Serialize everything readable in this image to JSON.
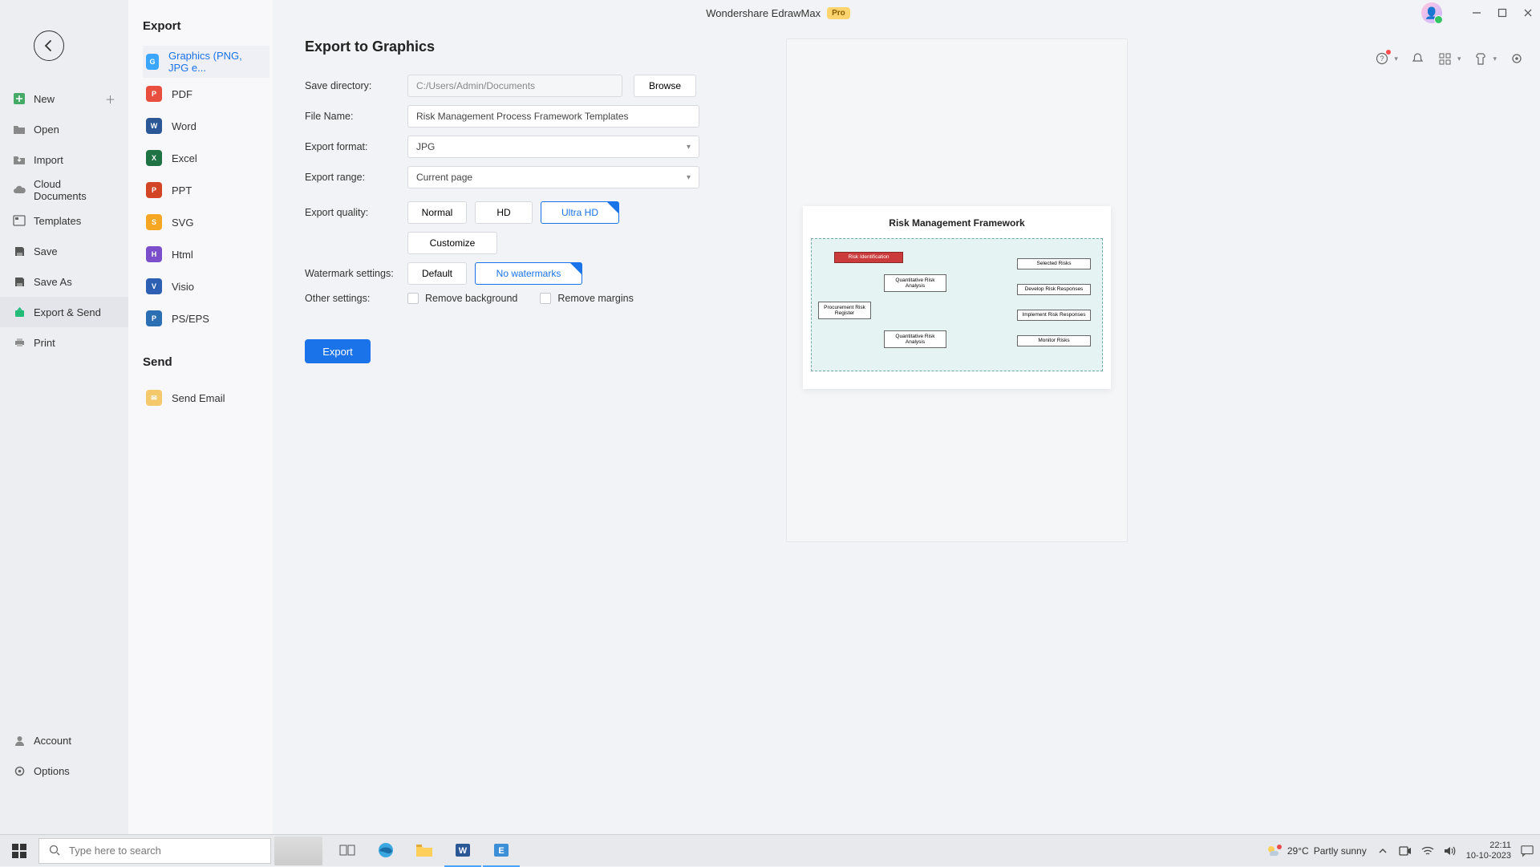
{
  "titlebar": {
    "app_title": "Wondershare EdrawMax",
    "pro_badge": "Pro"
  },
  "leftnav": {
    "items": [
      {
        "label": "New"
      },
      {
        "label": "Open"
      },
      {
        "label": "Import"
      },
      {
        "label": "Cloud Documents"
      },
      {
        "label": "Templates"
      },
      {
        "label": "Save"
      },
      {
        "label": "Save As"
      },
      {
        "label": "Export & Send"
      },
      {
        "label": "Print"
      }
    ],
    "account": "Account",
    "options": "Options"
  },
  "exportcol": {
    "heading_export": "Export",
    "heading_send": "Send",
    "formats": [
      {
        "label": "Graphics (PNG, JPG e..."
      },
      {
        "label": "PDF"
      },
      {
        "label": "Word"
      },
      {
        "label": "Excel"
      },
      {
        "label": "PPT"
      },
      {
        "label": "SVG"
      },
      {
        "label": "Html"
      },
      {
        "label": "Visio"
      },
      {
        "label": "PS/EPS"
      }
    ],
    "send_email": "Send Email"
  },
  "form": {
    "heading": "Export to Graphics",
    "save_dir_label": "Save directory:",
    "save_dir_value": "C:/Users/Admin/Documents",
    "browse": "Browse",
    "file_name_label": "File Name:",
    "file_name_value": "Risk Management Process Framework Templates",
    "export_format_label": "Export format:",
    "export_format_value": "JPG",
    "export_range_label": "Export range:",
    "export_range_value": "Current page",
    "export_quality_label": "Export quality:",
    "quality_normal": "Normal",
    "quality_hd": "HD",
    "quality_ultra": "Ultra HD",
    "customize": "Customize",
    "watermark_label": "Watermark settings:",
    "watermark_default": "Default",
    "watermark_none": "No watermarks",
    "other_label": "Other settings:",
    "remove_bg": "Remove background",
    "remove_margins": "Remove margins",
    "export_btn": "Export"
  },
  "preview": {
    "title": "Risk Management Framework",
    "boxes": {
      "risk_id": "Risk Identification",
      "qual": "Quantitative Risk Analysis",
      "proc": "Procurement Risk Register",
      "quant2": "Quantitative Risk Analysis",
      "sel": "Selected Risks",
      "dev": "Develop Risk Responses",
      "impl": "Implement Risk Responses",
      "mon": "Monitor Risks"
    }
  },
  "taskbar": {
    "search_placeholder": "Type here to search",
    "weather_temp": "29°C",
    "weather_desc": "Partly sunny",
    "time": "22:11",
    "date": "10-10-2023"
  },
  "colors": {
    "accent": "#1a73e8"
  }
}
